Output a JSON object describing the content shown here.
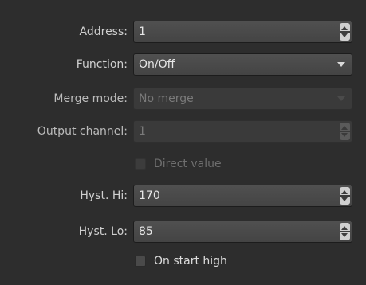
{
  "form": {
    "address": {
      "label": "Address:",
      "value": "1"
    },
    "function": {
      "label": "Function:",
      "value": "On/Off"
    },
    "merge_mode": {
      "label": "Merge mode:",
      "value": "No merge"
    },
    "output_channel": {
      "label": "Output channel:",
      "value": "1"
    },
    "direct_value": {
      "label": "Direct value",
      "checked": false,
      "enabled": false
    },
    "hyst_hi": {
      "label": "Hyst. Hi:",
      "value": "170"
    },
    "hyst_lo": {
      "label": "Hyst. Lo:",
      "value": "85"
    },
    "on_start_high": {
      "label": "On start high",
      "checked": false,
      "enabled": true
    }
  },
  "icons": {
    "spin": "spin-arrows-icon",
    "dropdown": "chevron-down-icon"
  },
  "colors": {
    "background": "#2d2d2d",
    "field": "#4a4a4a",
    "text": "#e6e6e6",
    "disabled_text": "#7a7a7a"
  }
}
